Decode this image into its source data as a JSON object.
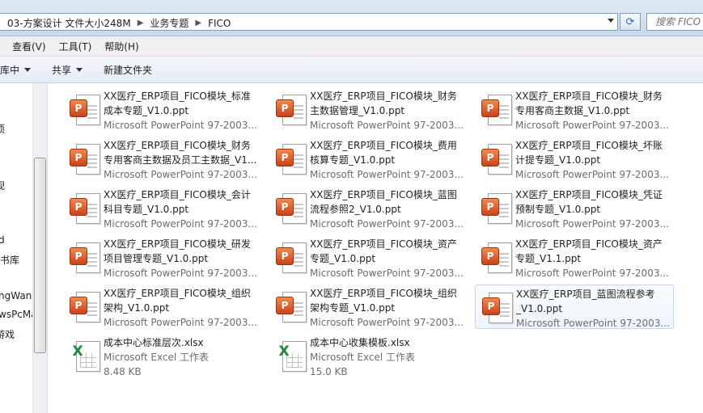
{
  "address": {
    "segments": [
      "03-方案设计 文件大小248M",
      "业务专题",
      "FICO"
    ],
    "search_placeholder": "搜索 FICO"
  },
  "menu": [
    "查看(V)",
    "工具(T)",
    "帮助(H)"
  ],
  "commands": [
    {
      "label": "包含到库中",
      "dropdown": true
    },
    {
      "label": "共享",
      "dropdown": true
    },
    {
      "label": "新建文件夹",
      "dropdown": false
    }
  ],
  "nav_items": [
    "项",
    "视",
    "d",
    "书库",
    "ngWan",
    "wsPcMa",
    "游戏"
  ],
  "files": [
    {
      "l1": "XX医疗_ERP项目_FICO模块_标准",
      "l2": "成本专题_V1.0.ppt",
      "meta": "Microsoft PowerPoint 97-2003...",
      "type": "ppt"
    },
    {
      "l1": "XX医疗_ERP项目_FICO模块_财务",
      "l2": "主数据管理_V1.0.ppt",
      "meta": "Microsoft PowerPoint 97-2003...",
      "type": "ppt"
    },
    {
      "l1": "XX医疗_ERP项目_FICO模块_财务",
      "l2": "专用客商主数据_V1.0.ppt",
      "meta": "Microsoft PowerPoint 97-2003...",
      "type": "ppt"
    },
    {
      "l1": "XX医疗_ERP项目_FICO模块_财务",
      "l2": "专用客商主数据及员工主数据_V1...",
      "meta": "Microsoft PowerPoint 97-2003...",
      "type": "ppt"
    },
    {
      "l1": "XX医疗_ERP项目_FICO模块_费用",
      "l2": "核算专题_V1.0.ppt",
      "meta": "Microsoft PowerPoint 97-2003...",
      "type": "ppt"
    },
    {
      "l1": "XX医疗_ERP项目_FICO模块_坏账",
      "l2": "计提专题_V1.0.ppt",
      "meta": "Microsoft PowerPoint 97-2003...",
      "type": "ppt"
    },
    {
      "l1": "XX医疗_ERP项目_FICO模块_会计",
      "l2": "科目专题_V1.0.ppt",
      "meta": "Microsoft PowerPoint 97-2003...",
      "type": "ppt"
    },
    {
      "l1": "XX医疗_ERP项目_FICO模块_蓝图",
      "l2": "流程参照2_V1.0.ppt",
      "meta": "Microsoft PowerPoint 97-2003...",
      "type": "ppt"
    },
    {
      "l1": "XX医疗_ERP项目_FICO模块_凭证",
      "l2": "预制专题_V1.0.ppt",
      "meta": "Microsoft PowerPoint 97-2003...",
      "type": "ppt"
    },
    {
      "l1": "XX医疗_ERP项目_FICO模块_研发",
      "l2": "项目管理专题_V1.0.ppt",
      "meta": "Microsoft PowerPoint 97-2003...",
      "type": "ppt"
    },
    {
      "l1": "XX医疗_ERP项目_FICO模块_资产",
      "l2": "专题_V1.0.ppt",
      "meta": "Microsoft PowerPoint 97-2003...",
      "type": "ppt"
    },
    {
      "l1": "XX医疗_ERP项目_FICO模块_资产",
      "l2": "专题_V1.1.ppt",
      "meta": "Microsoft PowerPoint 97-2003...",
      "type": "ppt"
    },
    {
      "l1": "XX医疗_ERP项目_FICO模块_组织",
      "l2": "架构_V1.0.ppt",
      "meta": "Microsoft PowerPoint 97-2003...",
      "type": "ppt"
    },
    {
      "l1": "XX医疗_ERP项目_FICO模块_组织",
      "l2": "架构专题_V1.0.ppt",
      "meta": "Microsoft PowerPoint 97-2003...",
      "type": "ppt"
    },
    {
      "l1": "XX医疗_ERP项目_蓝图流程参考",
      "l2": "_V1.0.ppt",
      "meta": "Microsoft PowerPoint 97-2003...",
      "type": "ppt",
      "selected": true
    },
    {
      "l1": "成本中心标准层次.xlsx",
      "l2": "Microsoft Excel 工作表",
      "meta": "8.48 KB",
      "type": "xls"
    },
    {
      "l1": "成本中心收集模板.xlsx",
      "l2": "Microsoft Excel 工作表",
      "meta": "15.0 KB",
      "type": "xls"
    }
  ]
}
